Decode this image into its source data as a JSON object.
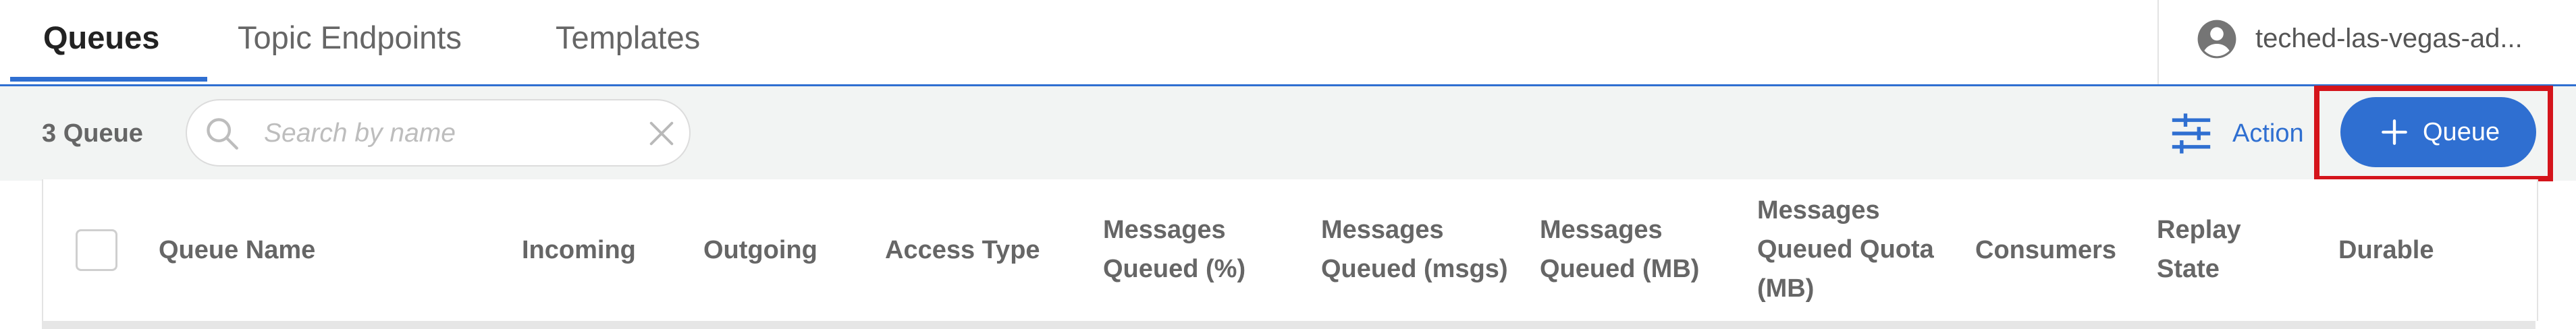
{
  "tabs": [
    {
      "label": "Queues",
      "active": true
    },
    {
      "label": "Topic Endpoints",
      "active": false
    },
    {
      "label": "Templates",
      "active": false
    }
  ],
  "user": {
    "name": "teched-las-vegas-ad...",
    "icon": "account-circle-icon"
  },
  "toolbar": {
    "count_label": "3 Queue",
    "search_placeholder": "Search by name",
    "search_value": "",
    "action_label": "Action",
    "add_button_label": "Queue"
  },
  "table": {
    "columns": [
      [
        "Queue Name"
      ],
      [
        "Incoming"
      ],
      [
        "Outgoing"
      ],
      [
        "Access Type"
      ],
      [
        "Messages",
        "Queued (%)"
      ],
      [
        "Messages",
        "Queued (msgs)"
      ],
      [
        "Messages",
        "Queued (MB)"
      ],
      [
        "Messages",
        "Queued Quota",
        "(MB)"
      ],
      [
        "Consumers"
      ],
      [
        "Replay",
        "State"
      ],
      [
        "Durable"
      ]
    ]
  },
  "colors": {
    "accent": "#2f6fd1",
    "highlight": "#d4141b",
    "toolbar_bg": "#f2f4f3"
  }
}
